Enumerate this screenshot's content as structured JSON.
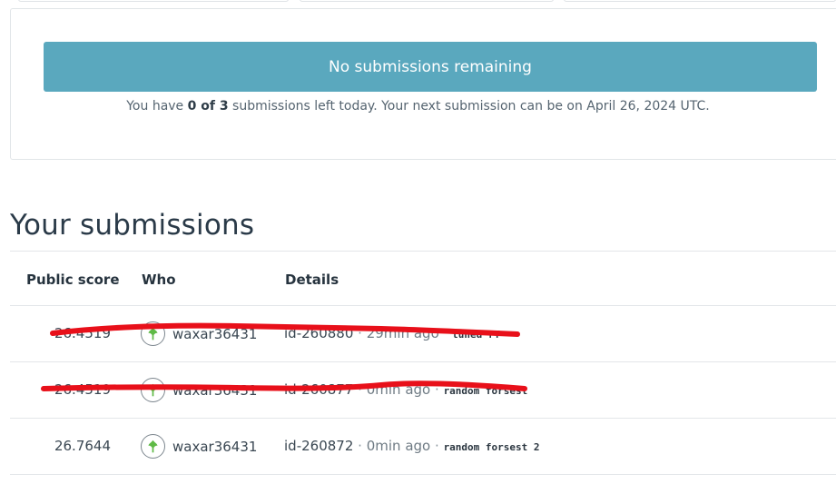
{
  "status": {
    "button_label": "No submissions remaining",
    "note_prefix": "You have ",
    "note_bold": "0 of 3",
    "note_suffix": " submissions left today. Your next submission can be on April 26, 2024 UTC."
  },
  "section_title": "Your submissions",
  "table": {
    "headers": {
      "score": "Public score",
      "who": "Who",
      "details": "Details"
    },
    "separator": "·",
    "rows": [
      {
        "score": "26.4519",
        "who": "waxar36431",
        "id": "id-260880",
        "time": "29min ago",
        "desc": "tuned rf",
        "struck": true
      },
      {
        "score": "26.4519",
        "who": "waxar36431",
        "id": "id-260877",
        "time": "0min ago",
        "desc": "random forsest",
        "struck": true
      },
      {
        "score": "26.7644",
        "who": "waxar36431",
        "id": "id-260872",
        "time": "0min ago",
        "desc": "random forsest 2",
        "struck": false
      }
    ]
  },
  "colors": {
    "status_bar": "#5aa8be",
    "strike": "#e8101a",
    "avatar_leaf": "#5fba46"
  },
  "icons": {
    "avatar": "leaf-avatar-icon"
  }
}
